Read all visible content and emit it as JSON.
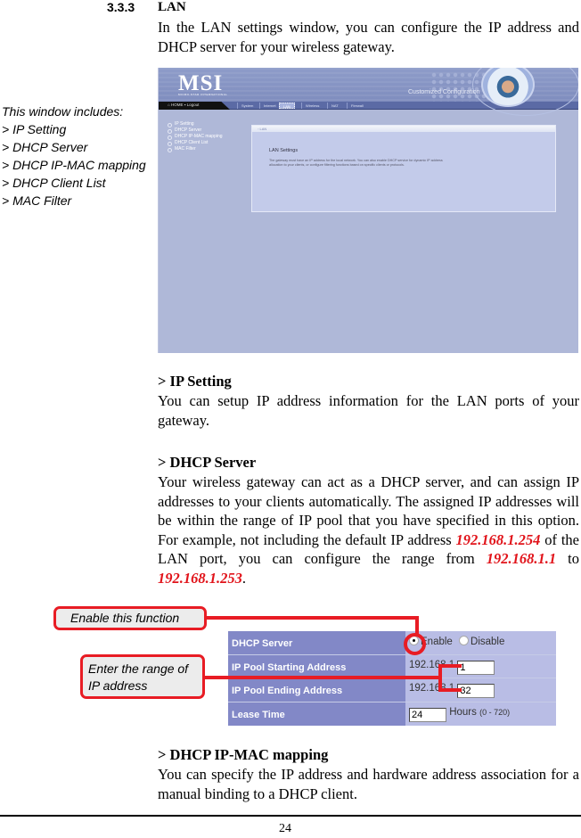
{
  "section": {
    "number": "3.3.3",
    "title": "LAN",
    "intro": "In the LAN settings window, you can configure the IP address and DHCP server for your wireless gateway."
  },
  "side_note": {
    "heading": "This window includes:",
    "items": [
      "> IP Setting",
      "> DHCP Server",
      "> DHCP IP-MAC mapping",
      "> DHCP Client List",
      "> MAC Filter"
    ]
  },
  "screenshot": {
    "logo": "MSI",
    "logo_sub": "MICRO-STAR INTERNATIONAL",
    "tagline": "Customized Configuration",
    "nav_home": "HOME",
    "nav_logout": "Logout",
    "tabs": [
      "System",
      "Internet",
      "LAN",
      "Wireless",
      "NAT",
      "Firewall"
    ],
    "active_tab": "LAN",
    "menu": [
      "IP Setting",
      "DHCP Server",
      "DHCP IP-MAC mapping",
      "DHCP Client List",
      "MAC Filter"
    ],
    "panel_title": "LAN",
    "panel_heading": "LAN Settings",
    "panel_text": "The gateway must have an IP address for the local network. You can also enable DHCP service for dynamic IP address allocation to your clients, or configure filtering functions based on specific clients or protocols."
  },
  "ip_setting": {
    "heading": "> IP Setting",
    "body": "You can setup IP address information for the LAN ports of your gateway."
  },
  "dhcp_server": {
    "heading": "> DHCP Server",
    "body_1": "Your wireless gateway can act as a DHCP server, and can assign IP addresses to your clients automatically.  The assigned IP addresses will be within the range of IP pool that you have specified in this option.  For example, not including the default IP address ",
    "default_ip": "192.168.1.254",
    "body_2": " of the LAN port, you can configure the range from ",
    "range_start": "192.168.1.1",
    "body_3": " to ",
    "range_end": "192.168.1.253",
    "body_4": "."
  },
  "callouts": {
    "enable": "Enable this function",
    "range_line1": "Enter the range of",
    "range_line2": "IP address"
  },
  "dhcp_form": {
    "rows": [
      {
        "label": "DHCP Server"
      },
      {
        "label": "IP Pool Starting Address",
        "prefix": "192.168.1.",
        "value": "1"
      },
      {
        "label": "IP Pool Ending Address",
        "prefix": "192.168.1.",
        "value": "32"
      },
      {
        "label": "Lease Time",
        "value": "24",
        "unit": "Hours",
        "range": "(0 - 720)"
      }
    ],
    "enable_label": "Enable",
    "disable_label": "Disable",
    "selected": "Enable"
  },
  "ip_mac": {
    "heading": "> DHCP IP-MAC mapping",
    "body": "You can specify the IP address and hardware address association for a manual binding to a DHCP client."
  },
  "page_number": "24",
  "colors": {
    "highlight_red": "#e1131a",
    "callout_border": "#e81c24",
    "form_label_bg": "#8288c7",
    "form_value_bg": "#b9bde5"
  }
}
